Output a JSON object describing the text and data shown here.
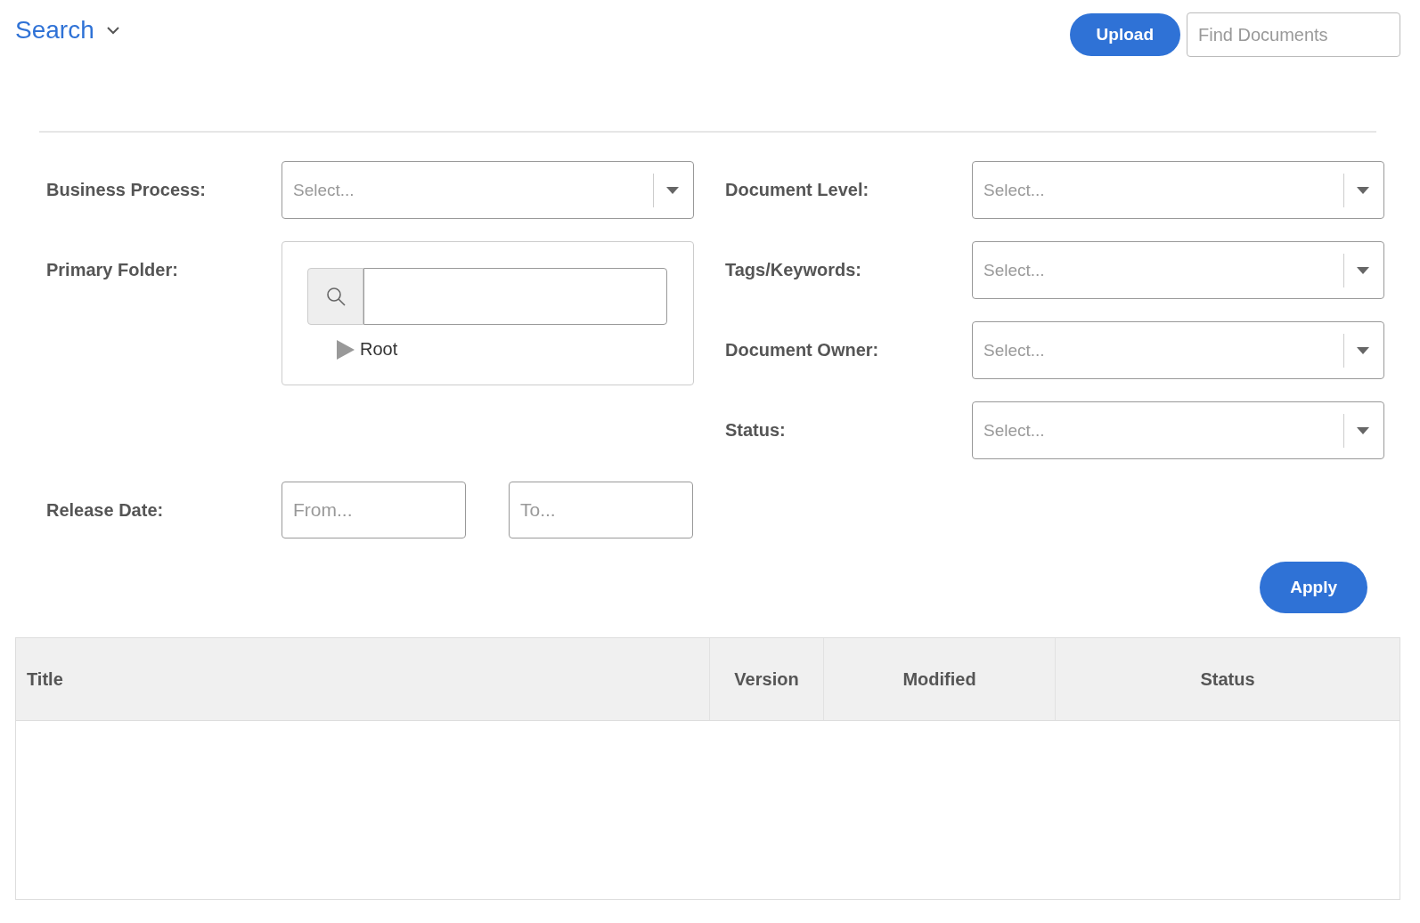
{
  "header": {
    "title": "Search",
    "upload_button": "Upload",
    "search": {
      "placeholder": "Find Documents"
    }
  },
  "filters_left": [
    {
      "kind": "select",
      "label": "Business Process:",
      "placeholder": "Select..."
    },
    {
      "kind": "folder",
      "label": "Primary Folder:",
      "tree": [
        {
          "label": "Root",
          "expanded": false
        }
      ]
    }
  ],
  "filters_right": [
    {
      "kind": "select",
      "label": "Document Level:",
      "placeholder": "Select..."
    },
    {
      "kind": "select",
      "label": "Tags/Keywords:",
      "placeholder": "Select..."
    },
    {
      "kind": "select",
      "label": "Document Owner:",
      "placeholder": "Select..."
    },
    {
      "kind": "select",
      "label": "Status:",
      "placeholder": "Select..."
    }
  ],
  "release_date": {
    "label": "Release Date:",
    "from": {
      "placeholder": "From..."
    },
    "to": {
      "placeholder": "To..."
    }
  },
  "apply_button": "Apply",
  "table": {
    "columns": [
      "Title",
      "Version",
      "Modified",
      "Status"
    ]
  }
}
